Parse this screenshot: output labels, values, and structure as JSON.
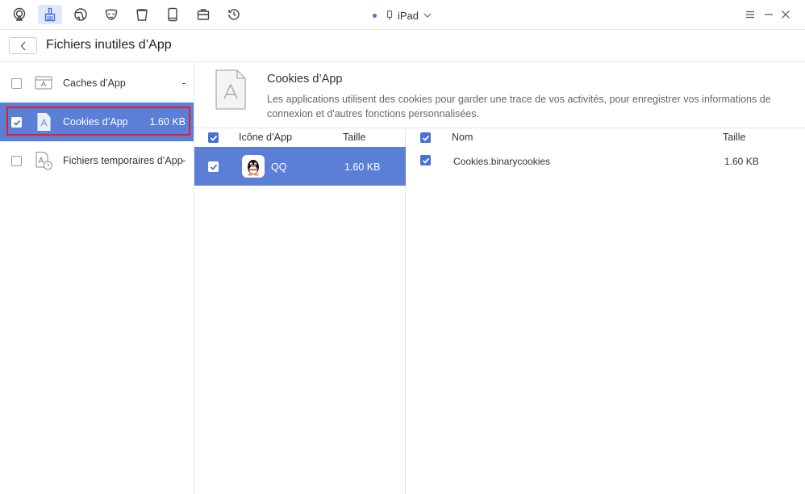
{
  "toolbar": {
    "icons": [
      "airplay-icon",
      "broom-icon",
      "globe-icon",
      "mask-icon",
      "trash-bin-icon",
      "tablet-icon",
      "briefcase-icon",
      "history-icon"
    ],
    "active_index": 1,
    "device_name": "iPad",
    "accent_color": "#4a6fd9"
  },
  "title_bar": {
    "title": "Fichiers inutiles d’App"
  },
  "categories": [
    {
      "label": "Caches d’App",
      "size": "-",
      "checked": false,
      "selected": false
    },
    {
      "label": "Cookies d’App",
      "size": "1.60 KB",
      "checked": true,
      "selected": true
    },
    {
      "label": "Fichiers temporaires d’App",
      "size": "-",
      "checked": false,
      "selected": false
    }
  ],
  "description": {
    "title": "Cookies d’App",
    "text": "Les applications utilisent des cookies pour garder une trace de vos activités, pour enregistrer vos informations de connexion et d'autres fonctions personnalisées."
  },
  "app_list": {
    "col_icon": "Icône d’App",
    "col_size": "Taille",
    "rows": [
      {
        "name": "QQ",
        "size": "1.60 KB",
        "checked": true
      }
    ]
  },
  "file_list": {
    "col_name": "Nom",
    "col_size": "Taille",
    "rows": [
      {
        "name": "Cookies.binarycookies",
        "size": "1.60 KB",
        "checked": true
      }
    ]
  }
}
